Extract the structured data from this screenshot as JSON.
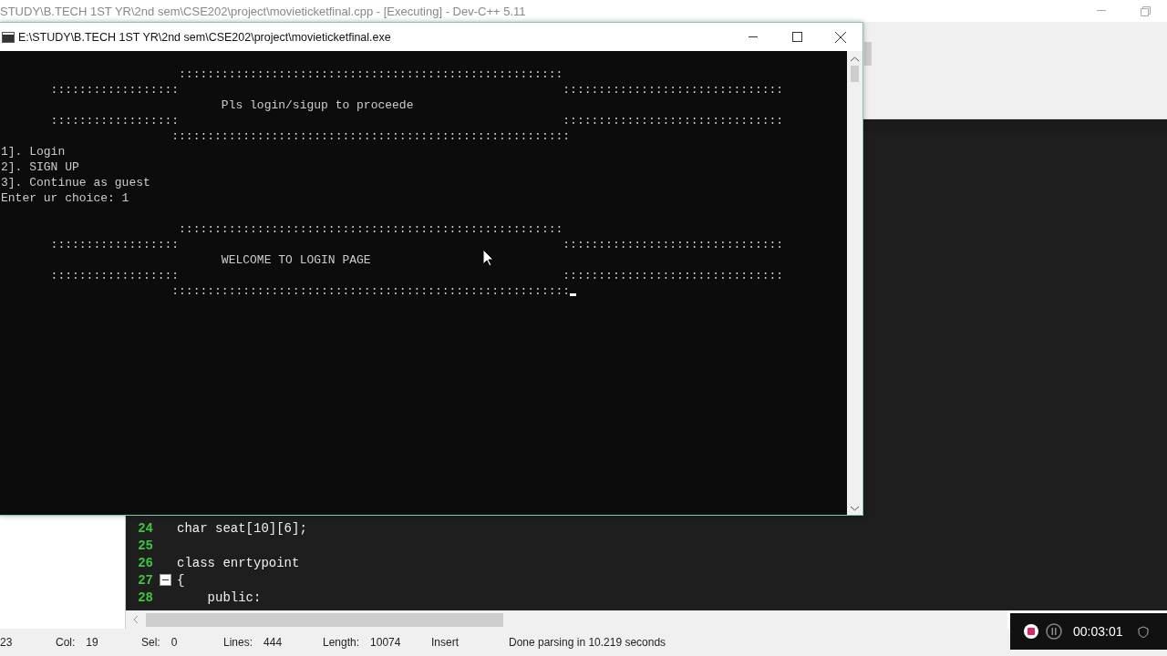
{
  "ide": {
    "title": "STUDY\\B.TECH 1ST YR\\2nd sem\\CSE202\\project\\movieticketfinal.cpp - [Executing] - Dev-C++ 5.11",
    "code_lines": [
      {
        "number": "24",
        "text": "char seat[10][6];",
        "fold": false
      },
      {
        "number": "25",
        "fold": false
      },
      {
        "number": "26",
        "text": "class enrtypoint",
        "fold": false
      },
      {
        "number": "27",
        "text": "{",
        "fold": true
      },
      {
        "number": "28",
        "text": "    public:",
        "fold": false
      }
    ],
    "status_bar": [
      {
        "value": "23"
      },
      {
        "label": "Col:",
        "value": "19"
      },
      {
        "label": "Sel:",
        "value": "0"
      },
      {
        "label": "Lines:",
        "value": "444"
      },
      {
        "label": "Length:",
        "value": "10074"
      },
      {
        "value": "Insert"
      },
      {
        "value": "Done parsing in 10.219 seconds"
      }
    ]
  },
  "console": {
    "title": "E:\\STUDY\\B.TECH 1ST YR\\2nd sem\\CSE202\\project\\movieticketfinal.exe",
    "blocks": [
      {
        "lines": [
          "                         ::::::::::::::::::::::::::::::::::::::::::::::::::::::",
          "       ::::::::::::::::::                                                      :::::::::::::::::::::::::::::::",
          "                               Pls login/sigup to proceede",
          "       ::::::::::::::::::                                                      :::::::::::::::::::::::::::::::",
          "                        ::::::::::::::::::::::::::::::::::::::::::::::::::::::::",
          "1]. Login",
          "2]. SIGN UP",
          "3]. Continue as guest",
          "Enter ur choice: 1"
        ]
      },
      {
        "lines": [
          "                         ::::::::::::::::::::::::::::::::::::::::::::::::::::::",
          "       ::::::::::::::::::                                                      :::::::::::::::::::::::::::::::",
          "                               WELCOME TO LOGIN PAGE",
          "       ::::::::::::::::::                                                      :::::::::::::::::::::::::::::::",
          "                        ::::::::::::::::::::::::::::::::::::::::::::::::::::::::"
        ]
      }
    ],
    "cursor_visible": true
  },
  "recorder": {
    "time": "00:03:01"
  }
}
